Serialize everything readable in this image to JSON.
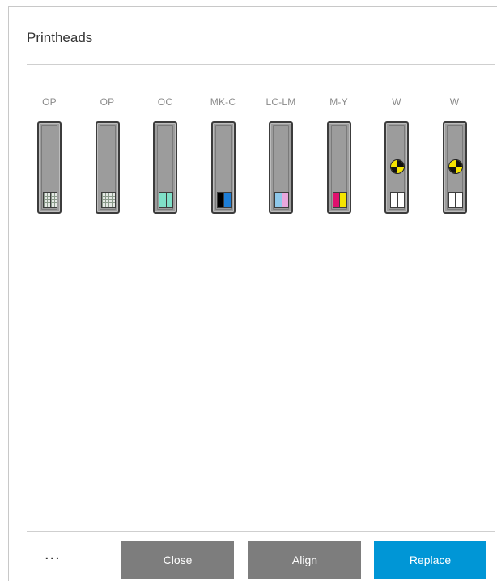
{
  "dialog": {
    "title": "Printheads"
  },
  "printheads": [
    {
      "label": "OP",
      "swatch": [
        "grid",
        "grid"
      ],
      "warning": false
    },
    {
      "label": "OP",
      "swatch": [
        "grid",
        "grid"
      ],
      "warning": false
    },
    {
      "label": "OC",
      "swatch": [
        "#7fe0c8",
        "#7fe0c8"
      ],
      "warning": false
    },
    {
      "label": "MK-C",
      "swatch": [
        "#000000",
        "#1e7ed6"
      ],
      "warning": false
    },
    {
      "label": "LC-LM",
      "swatch": [
        "#8ec8ea",
        "#e8a6dc"
      ],
      "warning": false
    },
    {
      "label": "M-Y",
      "swatch": [
        "#e0126e",
        "#f5e400"
      ],
      "warning": false
    },
    {
      "label": "W",
      "swatch": [
        "#ffffff",
        "#ffffff"
      ],
      "warning": true
    },
    {
      "label": "W",
      "swatch": [
        "#ffffff",
        "#ffffff"
      ],
      "warning": true
    }
  ],
  "footer": {
    "more_label": "...",
    "close_label": "Close",
    "align_label": "Align",
    "replace_label": "Replace"
  },
  "colors": {
    "accent": "#0096d6",
    "secondary_button": "#7d7d7d",
    "warning_yellow": "#f5e400"
  }
}
